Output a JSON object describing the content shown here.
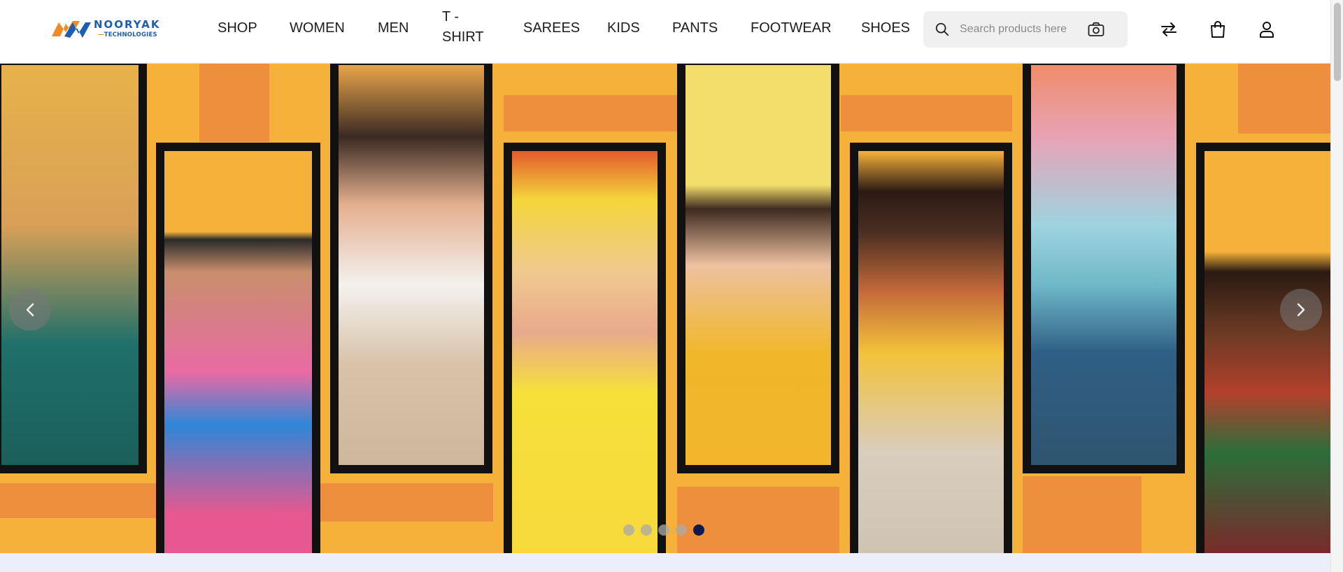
{
  "brand": {
    "logo_text": "NOORYAK",
    "logo_sub": "TECHNOLOGIES",
    "colors": {
      "blue": "#1c5fb2",
      "orange": "#f08a24"
    }
  },
  "nav": {
    "items": [
      {
        "label": "SHOP"
      },
      {
        "label": "WOMEN"
      },
      {
        "label": "MEN"
      },
      {
        "label": "T - SHIRT"
      },
      {
        "label": "SAREES"
      },
      {
        "label": "KIDS"
      },
      {
        "label": "PANTS"
      },
      {
        "label": "FOOTWEAR"
      },
      {
        "label": "SHOES"
      }
    ]
  },
  "search": {
    "placeholder": "Search products here",
    "value": "",
    "icon": "search-icon",
    "image_search_icon": "camera-icon"
  },
  "header_icons": [
    {
      "name": "compare-icon"
    },
    {
      "name": "shopping-bag-icon"
    },
    {
      "name": "user-icon"
    }
  ],
  "hero": {
    "background": "#f6b13a",
    "accent": "#ee8f3e",
    "slides_total": 5,
    "active_slide": 5,
    "prev_icon": "chevron-left-icon",
    "next_icon": "chevron-right-icon",
    "dot_active_color": "#0e1a4f"
  }
}
